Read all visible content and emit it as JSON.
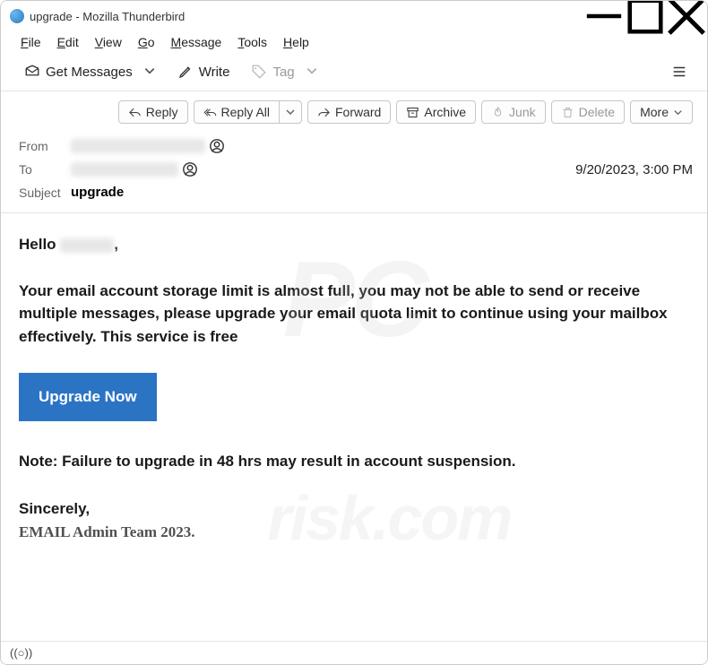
{
  "window": {
    "title": "upgrade - Mozilla Thunderbird"
  },
  "menubar": {
    "file": "File",
    "edit": "Edit",
    "view": "View",
    "go": "Go",
    "message": "Message",
    "tools": "Tools",
    "help": "Help"
  },
  "toolbar": {
    "get_messages": "Get Messages",
    "write": "Write",
    "tag": "Tag"
  },
  "actions": {
    "reply": "Reply",
    "reply_all": "Reply All",
    "forward": "Forward",
    "archive": "Archive",
    "junk": "Junk",
    "delete": "Delete",
    "more": "More"
  },
  "headers": {
    "from_label": "From",
    "to_label": "To",
    "subject_label": "Subject",
    "subject_value": "upgrade",
    "date": "9/20/2023, 3:00 PM"
  },
  "body": {
    "greeting_prefix": "Hello ",
    "greeting_suffix": ",",
    "main_text": "Your email account storage limit is almost full, you may not be able to send or receive multiple messages, please upgrade your email quota limit to continue using your mailbox effectively. This service is free",
    "upgrade_button": "Upgrade Now",
    "note": "Note: Failure to upgrade in 48 hrs may result in account suspension.",
    "sign1": "Sincerely,",
    "sign2": "EMAIL Admin Team 2023."
  },
  "statusbar": {
    "indicator": "((○))"
  },
  "watermark": {
    "line1": "PC",
    "line2": "risk.com"
  }
}
